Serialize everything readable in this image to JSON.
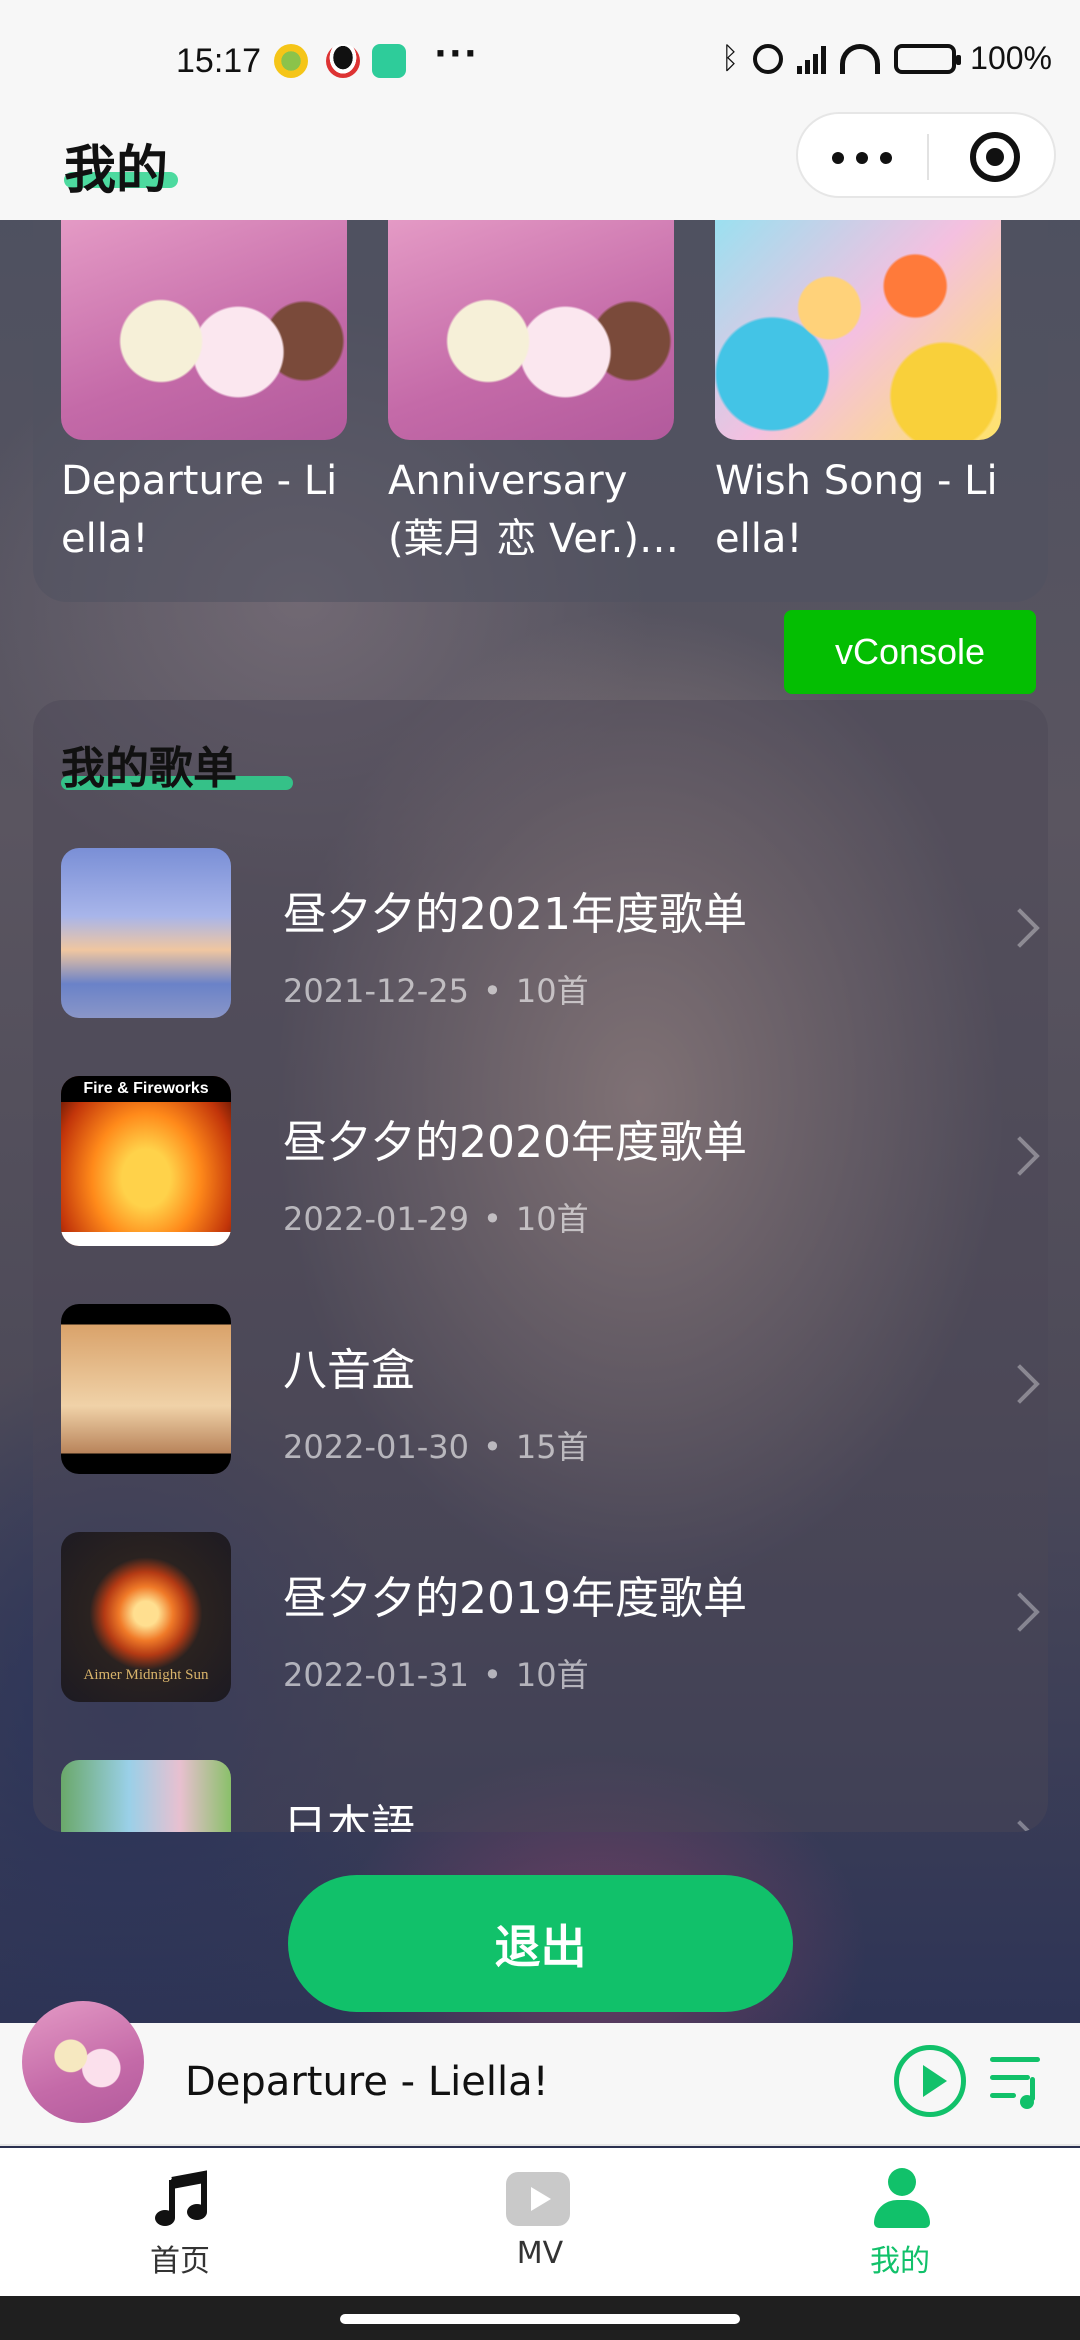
{
  "status_bar": {
    "time": "15:17",
    "dots": "···",
    "battery": "100%",
    "icons": [
      "bluetooth-icon",
      "alarm-icon",
      "signal-icon",
      "wifi-icon",
      "battery-icon"
    ]
  },
  "header": {
    "title": "我的"
  },
  "recent": {
    "items": [
      {
        "title": "Departure - Liella!",
        "cover": "pink"
      },
      {
        "title": "Anniversary (葉月 恋 Ver.) - Liella!",
        "cover": "pink"
      },
      {
        "title": "Wish Song - Liella!",
        "cover": "bright"
      }
    ]
  },
  "vconsole": {
    "label": "vConsole"
  },
  "playlists": {
    "title": "我的歌单",
    "items": [
      {
        "name": "昼夕夕的2021年度歌单",
        "date": "2021-12-25",
        "count": "10首"
      },
      {
        "name": "昼夕夕的2020年度歌单",
        "date": "2022-01-29",
        "count": "10首",
        "cover_text": "Fire & Fireworks"
      },
      {
        "name": "八音盒",
        "date": "2022-01-30",
        "count": "15首"
      },
      {
        "name": "昼夕夕的2019年度歌单",
        "date": "2022-01-31",
        "count": "10首",
        "cover_text": "Aimer Midnight Sun"
      },
      {
        "name": "日本語",
        "date": "",
        "count": ""
      }
    ]
  },
  "logout": {
    "label": "退出"
  },
  "player": {
    "title": "Departure - Liella!"
  },
  "tabs": [
    {
      "label": "首页",
      "icon": "music-note-icon"
    },
    {
      "label": "MV",
      "icon": "video-play-icon"
    },
    {
      "label": "我的",
      "icon": "person-icon",
      "active": true
    }
  ],
  "colors": {
    "accent": "#11c16a",
    "vconsole": "#04be02"
  }
}
